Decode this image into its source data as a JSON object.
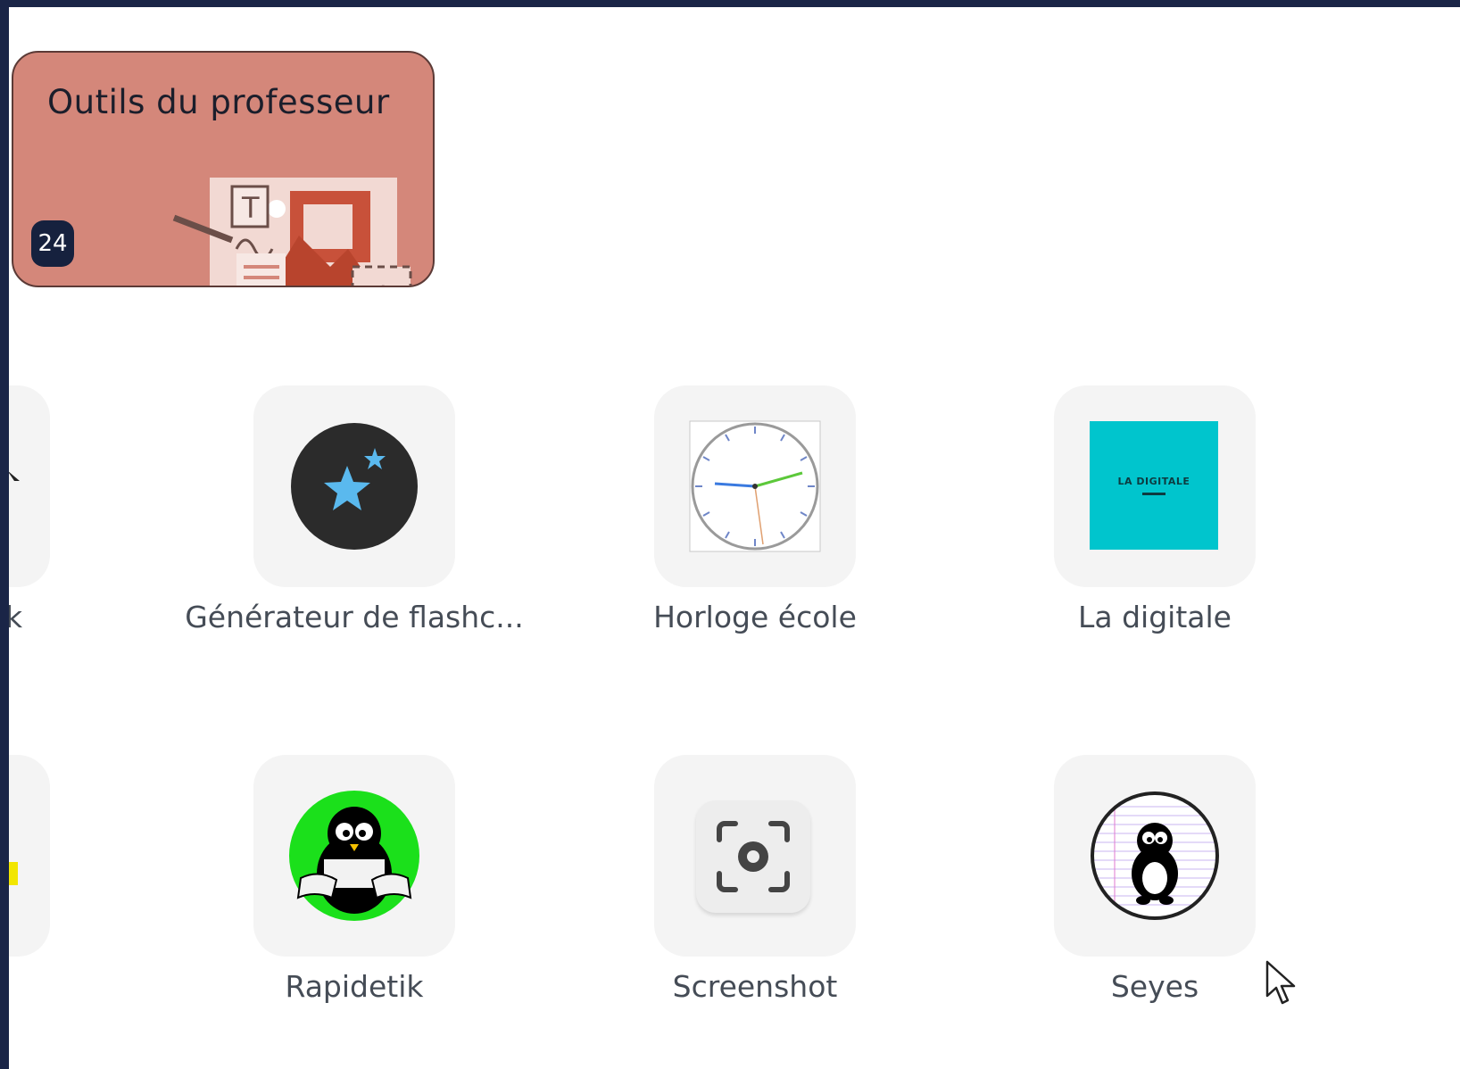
{
  "folder": {
    "title": "Outils du professeur",
    "count": "24",
    "color": "#d4877a"
  },
  "apps": [
    {
      "label": "Générateur de flashc...",
      "icon": "flashcard-stars-icon"
    },
    {
      "label": "Horloge école",
      "icon": "clock-icon"
    },
    {
      "label": "La digitale",
      "icon": "la-digitale-logo-icon",
      "logo_text": "LA DIGITALE"
    },
    {
      "label": "Rapidetik",
      "icon": "penguin-green-icon"
    },
    {
      "label": "Screenshot",
      "icon": "screenshot-camera-icon"
    },
    {
      "label": "Seyes",
      "icon": "penguin-seyes-icon"
    }
  ],
  "partial_labels": {
    "row1": "k"
  },
  "colors": {
    "background_frame": "#1a2547",
    "tile_bg": "#f4f4f4",
    "flashcard_circle": "#2b2b2b",
    "stars": "#5ab9ee",
    "digitale_teal": "#00c5cd",
    "rapidetik_green": "#1be01b"
  }
}
